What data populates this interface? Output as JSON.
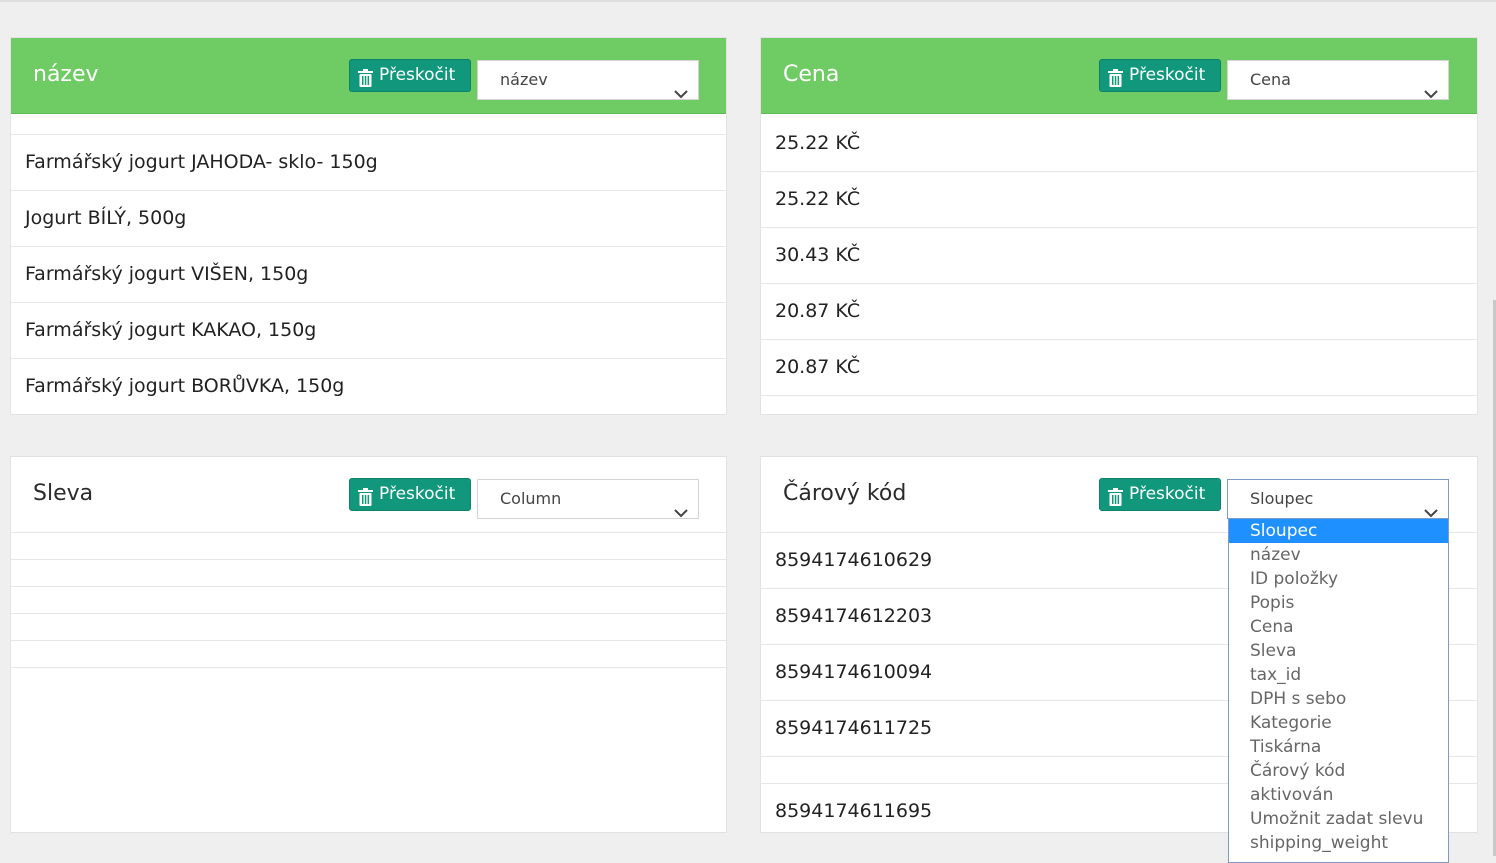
{
  "skip_label": "Přeskočit",
  "colors": {
    "accent_green": "#6fcb63",
    "button_teal": "#11987c",
    "dropdown_highlight": "#1e90ff"
  },
  "panels": {
    "nazev": {
      "title": "název",
      "select_value": "název",
      "rows": [
        "",
        "Farmářský jogurt JAHODA- sklo- 150g",
        "Jogurt BÍLÝ, 500g",
        "Farmářský jogurt VIŠEN, 150g",
        "Farmářský jogurt KAKAO, 150g",
        "Farmářský jogurt BORŮVKA, 150g"
      ]
    },
    "cena": {
      "title": "Cena",
      "select_value": "Cena",
      "rows": [
        "25.22 KČ",
        "25.22 KČ",
        "30.43 KČ",
        "20.87 KČ",
        "20.87 KČ"
      ]
    },
    "sleva": {
      "title": "Sleva",
      "select_value": "Column"
    },
    "carovy_kod": {
      "title": "Čárový kód",
      "select_value": "Sloupec",
      "rows": [
        "8594174610629",
        "8594174612203",
        "8594174610094",
        "8594174611725",
        "",
        "8594174611695"
      ]
    }
  },
  "dropdown": {
    "options": [
      "Sloupec",
      "název",
      "ID položky",
      "Popis",
      "Cena",
      "Sleva",
      "tax_id",
      "DPH s sebo",
      "Kategorie",
      "Tiskárna",
      "Čárový kód",
      "aktivován",
      "Umožnit zadat slevu",
      "shipping_weight"
    ],
    "selected": "Sloupec"
  },
  "icons": {
    "trash": "trash-icon",
    "chevron": "chevron-down-icon"
  }
}
